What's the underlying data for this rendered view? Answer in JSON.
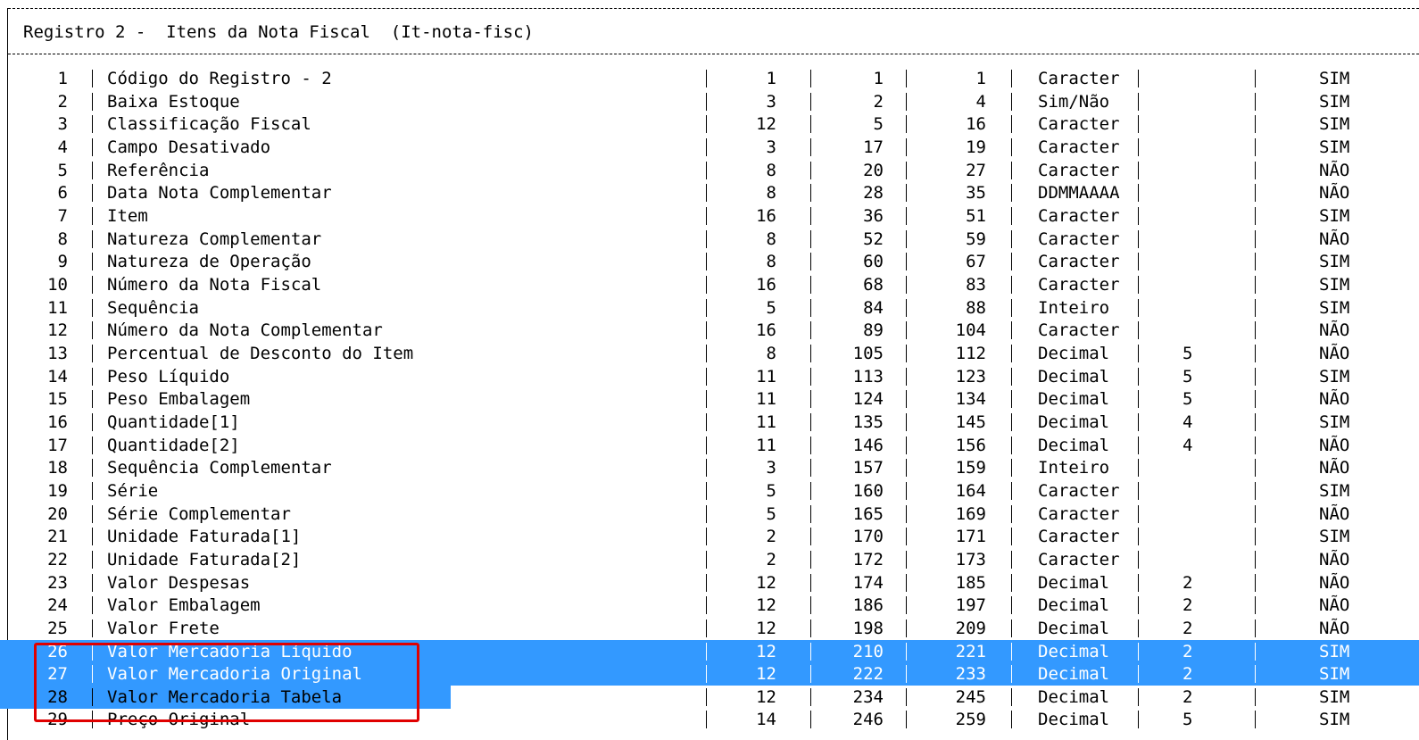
{
  "header": {
    "title": "Registro 2 -  Itens da Nota Fiscal  (It-nota-fisc)"
  },
  "rows": [
    {
      "n": "1",
      "name": "Código do Registro - 2",
      "size": "1",
      "ini": "1",
      "fim": "1",
      "type": "Caracter",
      "dec": "",
      "obr": "SIM"
    },
    {
      "n": "2",
      "name": "Baixa Estoque",
      "size": "3",
      "ini": "2",
      "fim": "4",
      "type": "Sim/Não",
      "dec": "",
      "obr": "SIM"
    },
    {
      "n": "3",
      "name": "Classificação Fiscal",
      "size": "12",
      "ini": "5",
      "fim": "16",
      "type": "Caracter",
      "dec": "",
      "obr": "SIM"
    },
    {
      "n": "4",
      "name": "Campo Desativado",
      "size": "3",
      "ini": "17",
      "fim": "19",
      "type": "Caracter",
      "dec": "",
      "obr": "SIM"
    },
    {
      "n": "5",
      "name": "Referência",
      "size": "8",
      "ini": "20",
      "fim": "27",
      "type": "Caracter",
      "dec": "",
      "obr": "NÃO"
    },
    {
      "n": "6",
      "name": "Data Nota Complementar",
      "size": "8",
      "ini": "28",
      "fim": "35",
      "type": "DDMMAAAA",
      "dec": "",
      "obr": "NÃO"
    },
    {
      "n": "7",
      "name": "Item",
      "size": "16",
      "ini": "36",
      "fim": "51",
      "type": "Caracter",
      "dec": "",
      "obr": "SIM"
    },
    {
      "n": "8",
      "name": "Natureza Complementar",
      "size": "8",
      "ini": "52",
      "fim": "59",
      "type": "Caracter",
      "dec": "",
      "obr": "NÃO"
    },
    {
      "n": "9",
      "name": "Natureza de Operação",
      "size": "8",
      "ini": "60",
      "fim": "67",
      "type": "Caracter",
      "dec": "",
      "obr": "SIM"
    },
    {
      "n": "10",
      "name": "Número da Nota Fiscal",
      "size": "16",
      "ini": "68",
      "fim": "83",
      "type": "Caracter",
      "dec": "",
      "obr": "SIM"
    },
    {
      "n": "11",
      "name": "Sequência",
      "size": "5",
      "ini": "84",
      "fim": "88",
      "type": "Inteiro",
      "dec": "",
      "obr": "SIM"
    },
    {
      "n": "12",
      "name": "Número da Nota Complementar",
      "size": "16",
      "ini": "89",
      "fim": "104",
      "type": "Caracter",
      "dec": "",
      "obr": "NÃO"
    },
    {
      "n": "13",
      "name": "Percentual de Desconto do Item",
      "size": "8",
      "ini": "105",
      "fim": "112",
      "type": "Decimal",
      "dec": "5",
      "obr": "NÃO"
    },
    {
      "n": "14",
      "name": "Peso Líquido",
      "size": "11",
      "ini": "113",
      "fim": "123",
      "type": "Decimal",
      "dec": "5",
      "obr": "SIM"
    },
    {
      "n": "15",
      "name": "Peso Embalagem",
      "size": "11",
      "ini": "124",
      "fim": "134",
      "type": "Decimal",
      "dec": "5",
      "obr": "NÃO"
    },
    {
      "n": "16",
      "name": "Quantidade[1]",
      "size": "11",
      "ini": "135",
      "fim": "145",
      "type": "Decimal",
      "dec": "4",
      "obr": "SIM"
    },
    {
      "n": "17",
      "name": "Quantidade[2]",
      "size": "11",
      "ini": "146",
      "fim": "156",
      "type": "Decimal",
      "dec": "4",
      "obr": "NÃO"
    },
    {
      "n": "18",
      "name": "Sequência Complementar",
      "size": "3",
      "ini": "157",
      "fim": "159",
      "type": "Inteiro",
      "dec": "",
      "obr": "NÃO"
    },
    {
      "n": "19",
      "name": "Série",
      "size": "5",
      "ini": "160",
      "fim": "164",
      "type": "Caracter",
      "dec": "",
      "obr": "SIM"
    },
    {
      "n": "20",
      "name": "Série Complementar",
      "size": "5",
      "ini": "165",
      "fim": "169",
      "type": "Caracter",
      "dec": "",
      "obr": "NÃO"
    },
    {
      "n": "21",
      "name": "Unidade Faturada[1]",
      "size": "2",
      "ini": "170",
      "fim": "171",
      "type": "Caracter",
      "dec": "",
      "obr": "SIM"
    },
    {
      "n": "22",
      "name": "Unidade Faturada[2]",
      "size": "2",
      "ini": "172",
      "fim": "173",
      "type": "Caracter",
      "dec": "",
      "obr": "NÃO"
    },
    {
      "n": "23",
      "name": "Valor Despesas",
      "size": "12",
      "ini": "174",
      "fim": "185",
      "type": "Decimal",
      "dec": "2",
      "obr": "NÃO"
    },
    {
      "n": "24",
      "name": "Valor Embalagem",
      "size": "12",
      "ini": "186",
      "fim": "197",
      "type": "Decimal",
      "dec": "2",
      "obr": "NÃO"
    },
    {
      "n": "25",
      "name": "Valor Frete",
      "size": "12",
      "ini": "198",
      "fim": "209",
      "type": "Decimal",
      "dec": "2",
      "obr": "NÃO"
    },
    {
      "n": "26",
      "name": "Valor Mercadoria Líquido",
      "size": "12",
      "ini": "210",
      "fim": "221",
      "type": "Decimal",
      "dec": "2",
      "obr": "SIM"
    },
    {
      "n": "27",
      "name": "Valor Mercadoria Original",
      "size": "12",
      "ini": "222",
      "fim": "233",
      "type": "Decimal",
      "dec": "2",
      "obr": "SIM"
    },
    {
      "n": "28",
      "name": "Valor Mercadoria Tabela",
      "size": "12",
      "ini": "234",
      "fim": "245",
      "type": "Decimal",
      "dec": "2",
      "obr": "SIM"
    },
    {
      "n": "29",
      "name": "Preço Original",
      "size": "14",
      "ini": "246",
      "fim": "259",
      "type": "Decimal",
      "dec": "5",
      "obr": "SIM"
    }
  ]
}
